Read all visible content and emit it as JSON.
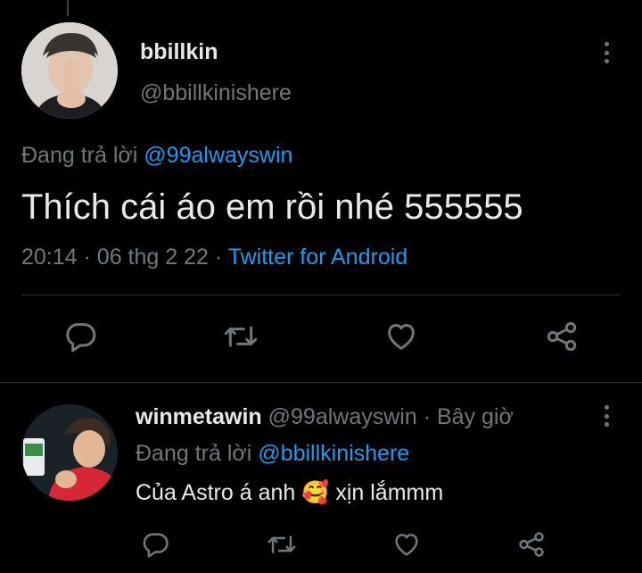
{
  "main_tweet": {
    "display_name": "bbillkin",
    "handle": "@bbillkinishere",
    "replying_prefix": "Đang trả lời",
    "replying_to": "@99alwayswin",
    "text": "Thích cái áo em rồi nhé 555555",
    "time": "20:14",
    "sep1": "·",
    "date": "06 thg 2 22",
    "sep2": "·",
    "source": "Twitter for Android"
  },
  "reply_tweet": {
    "display_name": "winmetawin",
    "handle": "@99alwayswin",
    "sep": "·",
    "time": "Bây giờ",
    "replying_prefix": "Đang trả lời",
    "replying_to": "@bbillkinishere",
    "text_before_emoji": "Của Astro á anh",
    "emoji": "🥰",
    "text_after_emoji": "xịn lắmmm"
  },
  "icons": {
    "reply": "reply-icon",
    "retweet": "retweet-icon",
    "like": "heart-icon",
    "share": "share-icon",
    "more": "more-dots-icon"
  },
  "colors": {
    "background": "#000000",
    "text": "#e7e9ea",
    "muted": "#71767b",
    "link": "#1d9bf0",
    "divider": "#2f3336"
  }
}
